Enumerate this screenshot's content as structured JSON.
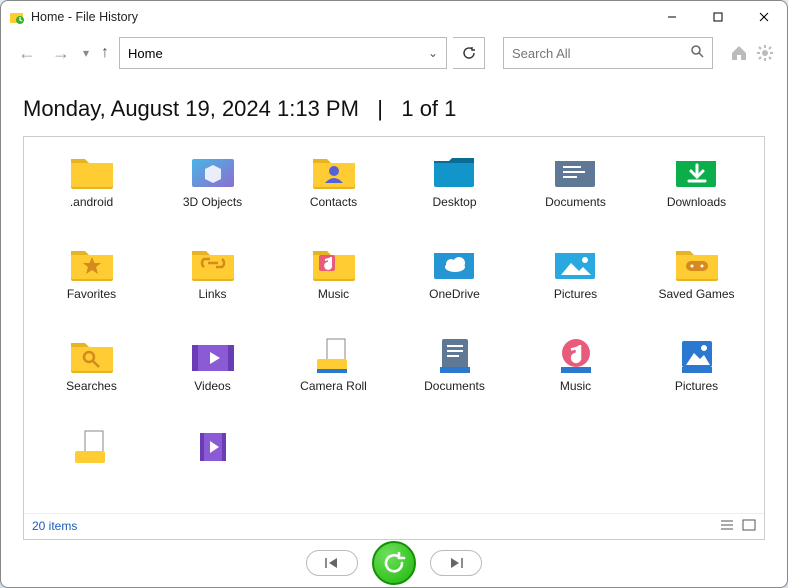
{
  "window": {
    "title": "Home - File History"
  },
  "nav": {
    "path": "Home"
  },
  "search": {
    "placeholder": "Search All"
  },
  "header": {
    "date": "Monday, August 19, 2024 1:13 PM",
    "sep": "|",
    "pager": "1 of 1"
  },
  "items": [
    {
      "label": ".android",
      "icon": "folder"
    },
    {
      "label": "3D Objects",
      "icon": "folder-3d"
    },
    {
      "label": "Contacts",
      "icon": "folder-contact"
    },
    {
      "label": "Desktop",
      "icon": "folder-desktop"
    },
    {
      "label": "Documents",
      "icon": "folder-docs"
    },
    {
      "label": "Downloads",
      "icon": "folder-downloads"
    },
    {
      "label": "Favorites",
      "icon": "folder-fav"
    },
    {
      "label": "Links",
      "icon": "folder-link"
    },
    {
      "label": "Music",
      "icon": "folder-music"
    },
    {
      "label": "OneDrive",
      "icon": "folder-cloud"
    },
    {
      "label": "Pictures",
      "icon": "folder-pic"
    },
    {
      "label": "Saved Games",
      "icon": "folder-game"
    },
    {
      "label": "Searches",
      "icon": "folder-search"
    },
    {
      "label": "Videos",
      "icon": "folder-video"
    },
    {
      "label": "Camera Roll",
      "icon": "lib-camera"
    },
    {
      "label": "Documents",
      "icon": "lib-docs"
    },
    {
      "label": "Music",
      "icon": "lib-music"
    },
    {
      "label": "Pictures",
      "icon": "lib-pic"
    },
    {
      "label": "",
      "icon": "lib-plain"
    },
    {
      "label": "",
      "icon": "lib-vid"
    }
  ],
  "status": {
    "count": "20 items"
  }
}
